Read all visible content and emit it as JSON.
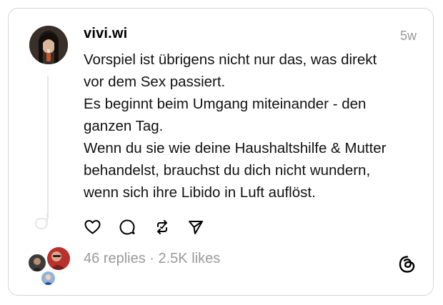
{
  "post": {
    "username": "vivi.wi",
    "time": "5w",
    "text": "Vorspiel ist übrigens nicht nur das, was direkt\nvor dem Sex passiert.\nEs beginnt beim Umgang miteinander - den\nganzen Tag.\nWenn du sie wie deine Haushaltshilfe & Mutter\nbehandelst, brauchst du dich nicht wundern,\nwenn sich ihre Libido in Luft auflöst.",
    "replies": "46 replies",
    "separator": " · ",
    "likes": "2.5K likes"
  },
  "icons": {
    "like": "heart-icon",
    "reply": "comment-icon",
    "repost": "repost-icon",
    "share": "send-icon",
    "brand": "threads-logo-icon"
  },
  "colors": {
    "muted": "#9a9a9a",
    "border": "#d6d6d6",
    "thread_line": "#e6e6e6"
  }
}
